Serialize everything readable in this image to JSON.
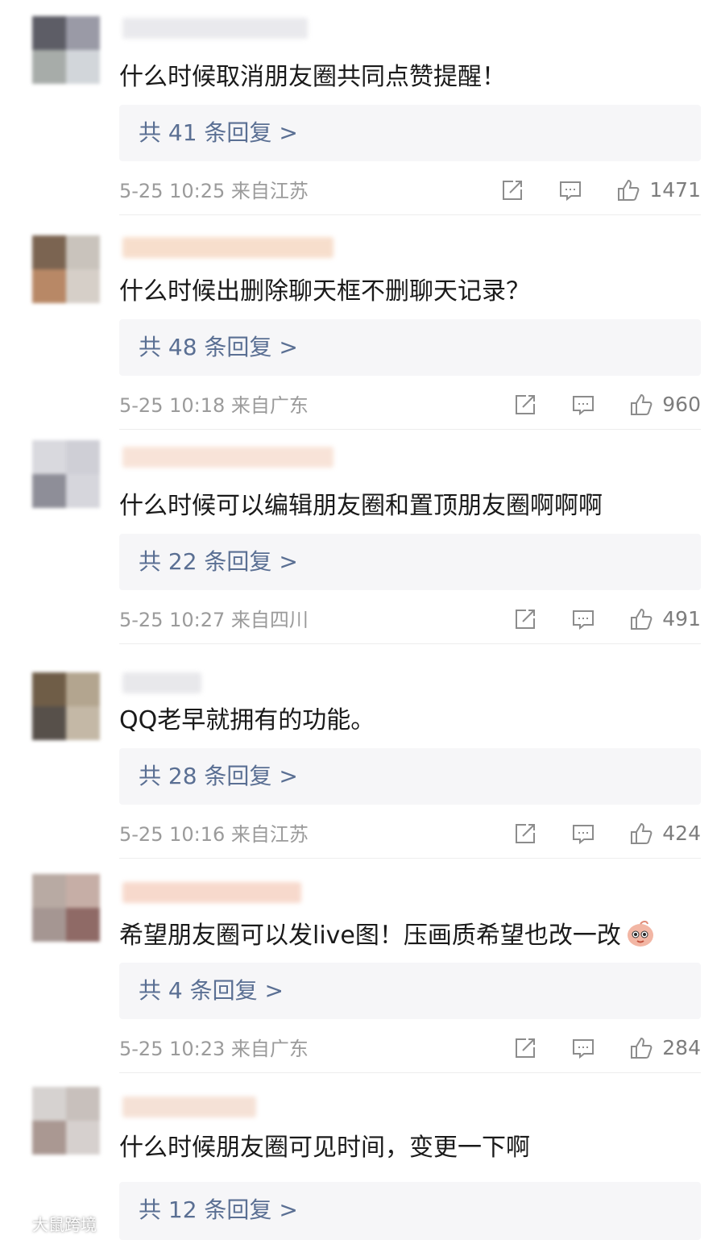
{
  "comments": [
    {
      "text": "什么时候取消朋友圈共同点赞提醒！",
      "replies": "共 41 条回复 >",
      "time": "5-25 10:25 来自江苏",
      "likes": "1471",
      "avatar_colors": [
        "#5d5d66",
        "#9a9aa6",
        "#a7aca9",
        "#d2d6da"
      ],
      "username_color": "#e6e6ea"
    },
    {
      "text": "什么时候出删除聊天框不删聊天记录？",
      "replies": "共 48 条回复 >",
      "time": "5-25 10:18 来自广东",
      "likes": "960",
      "avatar_colors": [
        "#7b6451",
        "#c9c3bc",
        "#b88866",
        "#d6cfc8"
      ],
      "username_color": "#f6d9c4"
    },
    {
      "text": "什么时候可以编辑朋友圈和置顶朋友圈啊啊啊",
      "replies": "共 22 条回复 >",
      "time": "5-25 10:27 来自四川",
      "likes": "491",
      "avatar_colors": [
        "#d9d9de",
        "#cfcfd6",
        "#8e8e98",
        "#d6d6dc"
      ],
      "username_color": "#f7dfd2"
    },
    {
      "text": "QQ老早就拥有的功能。",
      "replies": "共 28 条回复 >",
      "time": "5-25 10:16 来自江苏",
      "likes": "424",
      "avatar_colors": [
        "#6f5d47",
        "#b3a58f",
        "#57504a",
        "#c4b8a6"
      ],
      "username_color": "#e4e4e8"
    },
    {
      "text": "希望朋友圈可以发live图！压画质希望也改一改",
      "replies": "共 4 条回复 >",
      "time": "5-25 10:23 来自广东",
      "likes": "284",
      "avatar_colors": [
        "#b8aaa3",
        "#c6aea6",
        "#a59692",
        "#8f6a66"
      ],
      "username_color": "#f6d3c4"
    },
    {
      "text": "什么时候朋友圈可见时间，变更一下啊",
      "replies": "共 12 条回复 >",
      "time": "",
      "likes": "",
      "avatar_colors": [
        "#d6d2d0",
        "#c8c0bc",
        "#aa9892",
        "#d6d0ce"
      ],
      "username_color": "#f4dccf"
    }
  ],
  "icons": {
    "share": "share-icon",
    "comment": "comment-icon",
    "like": "thumbs-up-icon",
    "emoji": "emoji-sticker-icon"
  },
  "colors": {
    "reply_text": "#5a6f93",
    "reply_bg": "#f6f6f8",
    "meta_text": "#9b9b9b"
  },
  "watermark": {
    "text": "大鼠跨境"
  }
}
